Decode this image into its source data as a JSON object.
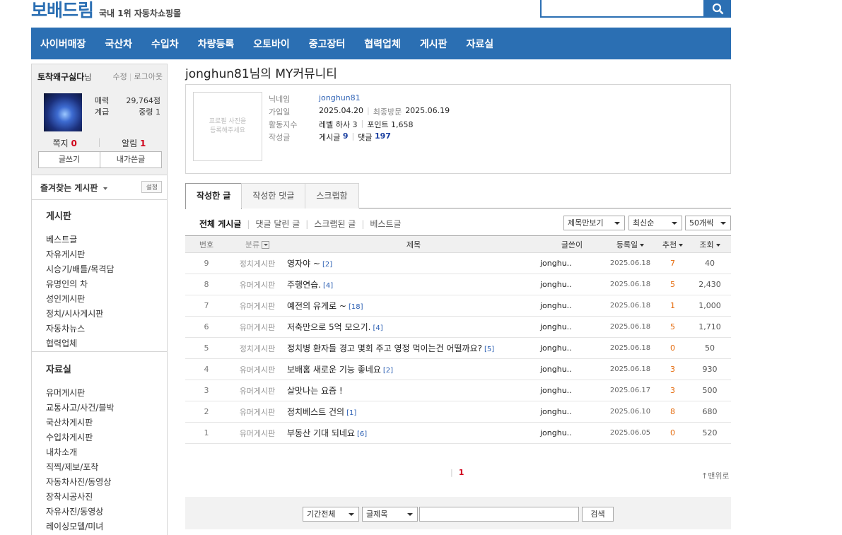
{
  "header": {
    "logo": "보배드림",
    "slogan": "국내 1위 자동차쇼핑몰",
    "search_placeholder": ""
  },
  "gnb": [
    "사이버매장",
    "국산차",
    "수입차",
    "차량등록",
    "오토바이",
    "중고장터",
    "협력업체",
    "게시판",
    "자료실"
  ],
  "sidebar": {
    "user_name": "토착왜구싫다",
    "user_suffix": "님",
    "edit": "수정",
    "logout": "로그아웃",
    "charm_label": "매력",
    "charm_value": "29,764점",
    "rank_label": "계급",
    "rank_value": "중령 1",
    "note_label": "쪽지",
    "note_count": "0",
    "alarm_label": "알림",
    "alarm_count": "1",
    "write_btn": "글쓰기",
    "my_posts_btn": "내가쓴글",
    "fav_title": "즐겨찾는 게시판",
    "fav_setting": "설정",
    "board_title": "게시판",
    "board_items": [
      "베스트글",
      "자유게시판",
      "시승기/배틀/목격담",
      "유명인의 차",
      "성인게시판",
      "정치/시사게시판",
      "자동차뉴스",
      "협력업체"
    ],
    "archive_title": "자료실",
    "archive_items": [
      "유머게시판",
      "교통사고/사건/블박",
      "국산차게시판",
      "수입차게시판",
      "내차소개",
      "직찍/제보/포착",
      "자동차사진/동영상",
      "장착시공사진",
      "자유사진/동영상",
      "레이싱모델/미녀"
    ]
  },
  "main": {
    "page_title": "jonghun81님의 MY커뮤니티",
    "photo_text": "프로필 사진을\n등록해주세요",
    "profile": {
      "nick_label": "닉네임",
      "nick": "jonghun81",
      "join_label": "가입일",
      "join_date": "2025.04.20",
      "last_visit_label": "최종방문",
      "last_visit": "2025.06.19",
      "activity_label": "활동지수",
      "level": "레벨 하사 3",
      "point": "포인트 1,658",
      "posts_label": "작성글",
      "post_label": "게시글",
      "post_count": "9",
      "comment_label": "댓글",
      "comment_count": "197"
    },
    "tabs": [
      "작성한 글",
      "작성한 댓글",
      "스크랩함"
    ],
    "filters": [
      "전체 게시글",
      "댓글 달린 글",
      "스크랩된 글",
      "베스트글"
    ],
    "selects": {
      "view": "제목만보기",
      "sort": "최신순",
      "count": "50개씩"
    },
    "columns": {
      "no": "번호",
      "category": "분류",
      "title": "제목",
      "writer": "글쓴이",
      "date": "등록일",
      "recommend": "추천",
      "views": "조회"
    },
    "rows": [
      {
        "no": "9",
        "category": "정치게시판",
        "title": "영자야 ~",
        "comments": "[2]",
        "writer": "jonghu..",
        "date": "2025.06.18",
        "rec": "7",
        "views": "40"
      },
      {
        "no": "8",
        "category": "유머게시판",
        "title": "주행연습.",
        "comments": "[4]",
        "writer": "jonghu..",
        "date": "2025.06.18",
        "rec": "5",
        "views": "2,430"
      },
      {
        "no": "7",
        "category": "유머게시판",
        "title": "예전의 유게로 ~",
        "comments": "[18]",
        "writer": "jonghu..",
        "date": "2025.06.18",
        "rec": "1",
        "views": "1,000"
      },
      {
        "no": "6",
        "category": "유머게시판",
        "title": "저축만으로 5억 모으기.",
        "comments": "[4]",
        "writer": "jonghu..",
        "date": "2025.06.18",
        "rec": "5",
        "views": "1,710"
      },
      {
        "no": "5",
        "category": "정치게시판",
        "title": "정치병 환자들 경고 몇회 주고 영정 먹이는건 어떨까요?",
        "comments": "[5]",
        "writer": "jonghu..",
        "date": "2025.06.18",
        "rec": "0",
        "views": "50"
      },
      {
        "no": "4",
        "category": "유머게시판",
        "title": "보배홈 새로운 기능 좋네요",
        "comments": "[2]",
        "writer": "jonghu..",
        "date": "2025.06.18",
        "rec": "3",
        "views": "930"
      },
      {
        "no": "3",
        "category": "유머게시판",
        "title": "살맛나는 요즘 !",
        "comments": "",
        "writer": "jonghu..",
        "date": "2025.06.17",
        "rec": "3",
        "views": "500"
      },
      {
        "no": "2",
        "category": "유머게시판",
        "title": "정치베스트 건의",
        "comments": "[1]",
        "writer": "jonghu..",
        "date": "2025.06.10",
        "rec": "8",
        "views": "680"
      },
      {
        "no": "1",
        "category": "유머게시판",
        "title": "부동산 기대 되네요",
        "comments": "[6]",
        "writer": "jonghu..",
        "date": "2025.06.05",
        "rec": "0",
        "views": "520"
      }
    ],
    "page_current": "1",
    "to_top": "↑맨위로",
    "bottom_search": {
      "period": "기간전체",
      "field": "글제목",
      "button": "검색"
    }
  }
}
